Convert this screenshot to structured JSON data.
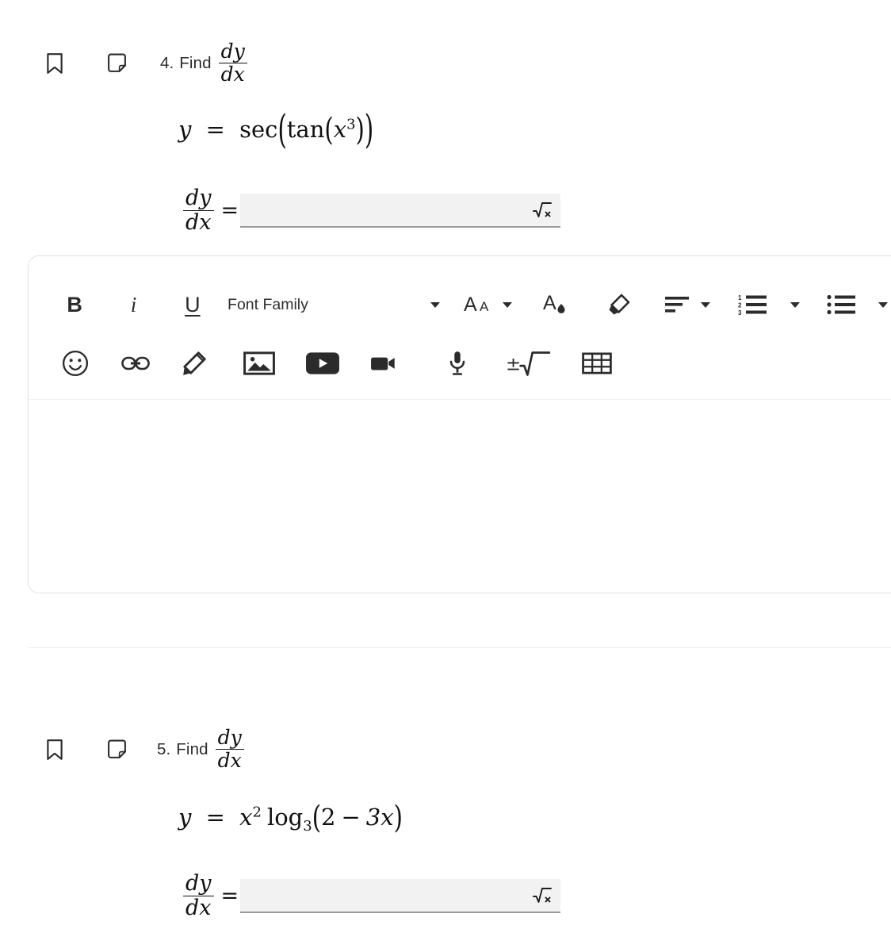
{
  "questions": [
    {
      "bookmark_icon": "bookmark-icon",
      "note_icon": "sticky-note-icon",
      "number": "4.",
      "prompt": "Find",
      "prompt_fraction": {
        "numerator": "dy",
        "denominator": "dx"
      },
      "equation": {
        "lhs": "y",
        "relation": "=",
        "rhs_plain": "sec(tan(x^3))",
        "function_outer": "sec",
        "function_inner": "tan",
        "argument_base": "x",
        "argument_exponent": "3"
      },
      "answer": {
        "label_numerator": "dy",
        "label_denominator": "dx",
        "relation": "=",
        "value": "",
        "placeholder": "",
        "math_keyboard_icon": "sqrt-x-icon"
      }
    },
    {
      "bookmark_icon": "bookmark-icon",
      "note_icon": "sticky-note-icon",
      "number": "5.",
      "prompt": "Find",
      "prompt_fraction": {
        "numerator": "dy",
        "denominator": "dx"
      },
      "equation": {
        "lhs": "y",
        "relation": "=",
        "rhs_plain": "x^2 log_3(2 - 3x)",
        "coefficient_base": "x",
        "coefficient_exponent": "2",
        "function": "log",
        "function_subscript": "3",
        "arg_first": "2",
        "arg_operator": "−",
        "arg_second": "3x"
      },
      "answer": {
        "label_numerator": "dy",
        "label_denominator": "dx",
        "relation": "=",
        "value": "",
        "placeholder": "",
        "math_keyboard_icon": "sqrt-x-icon"
      }
    }
  ],
  "editor": {
    "toolbar_row1": [
      {
        "name": "bold-button",
        "label": "B",
        "kind": "text"
      },
      {
        "name": "italic-button",
        "label": "i",
        "kind": "text"
      },
      {
        "name": "underline-button",
        "label": "U",
        "kind": "text"
      },
      {
        "name": "font-family-select",
        "label": "Font Family",
        "kind": "select"
      },
      {
        "name": "font-size-button",
        "label": "AA",
        "kind": "fontsize"
      },
      {
        "name": "text-color-button",
        "label": "",
        "kind": "textcolor"
      },
      {
        "name": "highlighter-button",
        "label": "",
        "kind": "highlight"
      },
      {
        "name": "align-button",
        "label": "",
        "kind": "align"
      },
      {
        "name": "numbered-list-button",
        "label": "",
        "kind": "numlist"
      },
      {
        "name": "bullet-list-button",
        "label": "",
        "kind": "bullist"
      }
    ],
    "toolbar_row2": [
      {
        "name": "emoji-button",
        "label": "",
        "kind": "emoji"
      },
      {
        "name": "link-button",
        "label": "",
        "kind": "link"
      },
      {
        "name": "draw-button",
        "label": "",
        "kind": "pencil"
      },
      {
        "name": "image-button",
        "label": "",
        "kind": "image"
      },
      {
        "name": "video-button",
        "label": "",
        "kind": "video"
      },
      {
        "name": "record-video-button",
        "label": "",
        "kind": "camera"
      },
      {
        "name": "record-audio-button",
        "label": "",
        "kind": "mic"
      },
      {
        "name": "math-equation-button",
        "label": "",
        "kind": "math"
      },
      {
        "name": "table-button",
        "label": "",
        "kind": "table"
      }
    ],
    "content": {
      "text": "",
      "placeholder": ""
    }
  },
  "colors": {
    "page_background": "#ffffff",
    "text": "#2c2c2c",
    "icon": "#2b2b2b",
    "field_fill": "#f2f2f2",
    "field_underline": "#9a9a9a",
    "panel_border": "#e2e2e2",
    "divider": "#ececec"
  }
}
